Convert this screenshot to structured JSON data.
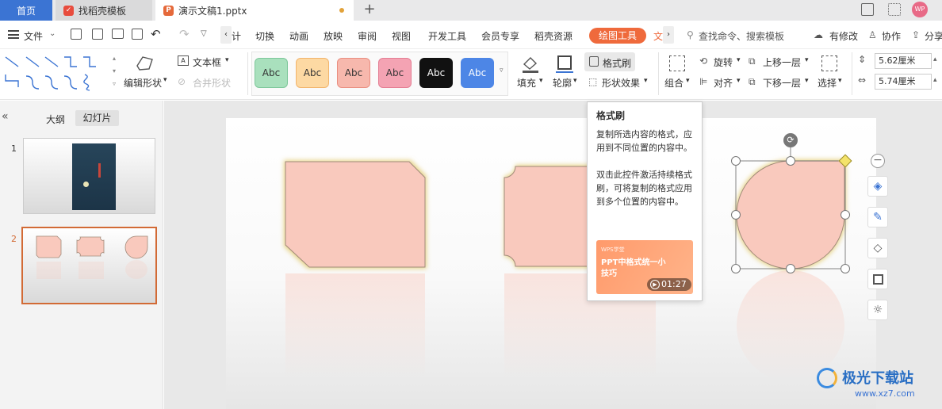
{
  "tabs": {
    "home": "首页",
    "daoke": "找稻壳模板",
    "doc": "演示文稿1.pptx",
    "add": "+"
  },
  "menu": {
    "file": "文件",
    "items": [
      "计",
      "切换",
      "动画",
      "放映",
      "审阅",
      "视图",
      "开发工具",
      "会员专享",
      "稻壳资源"
    ],
    "draw_tool": "绘图工具",
    "text_tool": "文",
    "search_placeholder": "查找命令、搜索模板",
    "has_changes": "有修改",
    "collab": "协作",
    "share": "分享"
  },
  "ribbon": {
    "edit_shape": "编辑形状",
    "textbox": "文本框",
    "merge_shape": "合并形状",
    "style_samples": [
      "Abc",
      "Abc",
      "Abc",
      "Abc",
      "Abc",
      "Abc"
    ],
    "fill": "填充",
    "outline": "轮廓",
    "format_painter": "格式刷",
    "shape_effects": "形状效果",
    "group": "组合",
    "rotate": "旋转",
    "align": "对齐",
    "bring_forward": "上移一层",
    "send_backward": "下移一层",
    "select": "选择",
    "height": "5.62厘米",
    "width": "5.74厘米"
  },
  "panel": {
    "outline_tab": "大纲",
    "slides_tab": "幻灯片",
    "slide_numbers": [
      "1",
      "2"
    ]
  },
  "tooltip": {
    "title": "格式刷",
    "para1": "复制所选内容的格式，应用到不同位置的内容中。",
    "para2": "双击此控件激活持续格式刷，可将复制的格式应用到多个位置的内容中。",
    "video_brand": "WPS学堂",
    "video_title": "PPT中格式统一小技巧",
    "video_duration": "01:27"
  },
  "watermark": {
    "name": "极光下载站",
    "url": "www.xz7.com"
  },
  "colors": {
    "accent": "#3b74d3",
    "draw_tool": "#ef6a3c",
    "shape_fill": "#f9c9bd",
    "shape_glow": "#e8d48a"
  }
}
